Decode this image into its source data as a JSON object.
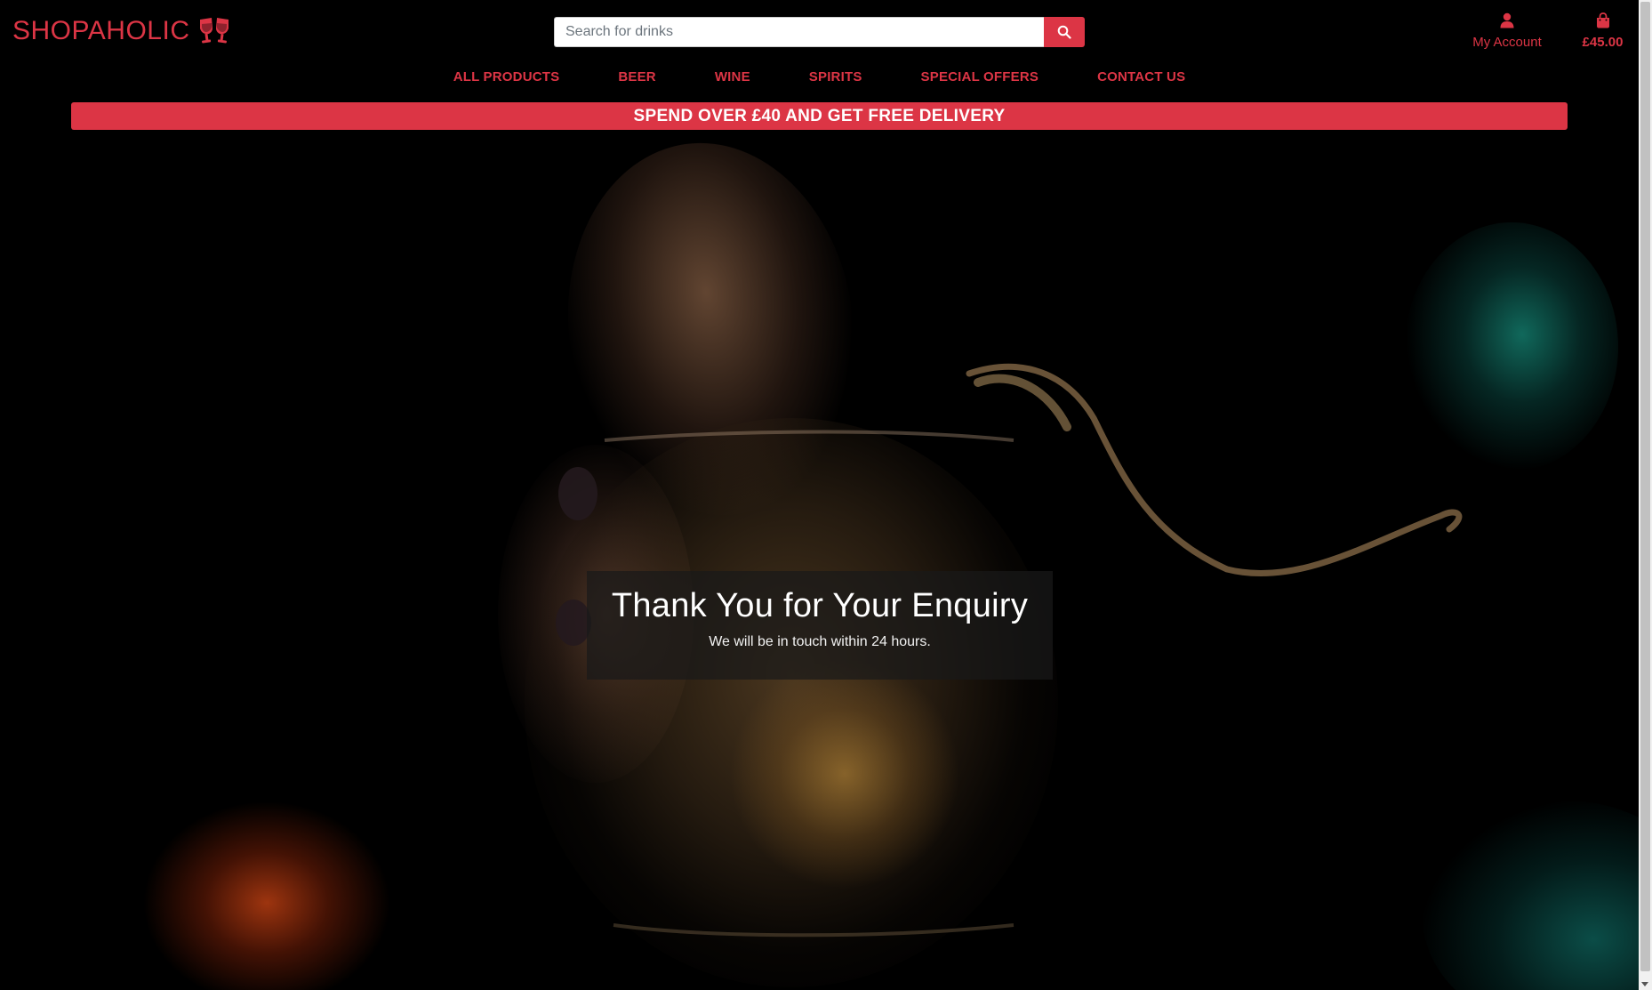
{
  "brand": {
    "name": "SHOPAHOLIC",
    "icon": "glasses-cheers-icon",
    "accent_color": "#dc3545"
  },
  "search": {
    "placeholder": "Search for drinks",
    "value": "",
    "button_icon": "search-icon"
  },
  "account": {
    "label": "My Account",
    "icon": "user-icon"
  },
  "bag": {
    "total": "£45.00",
    "icon": "shopping-bag-icon"
  },
  "nav": {
    "items": [
      {
        "label": "ALL PRODUCTS"
      },
      {
        "label": "BEER"
      },
      {
        "label": "WINE"
      },
      {
        "label": "SPIRITS"
      },
      {
        "label": "SPECIAL OFFERS"
      },
      {
        "label": "CONTACT US"
      }
    ]
  },
  "banner": {
    "text": "SPEND OVER £40 AND GET FREE DELIVERY"
  },
  "message": {
    "title": "Thank You for Your Enquiry",
    "subtitle": "We will be in touch within 24 hours."
  }
}
